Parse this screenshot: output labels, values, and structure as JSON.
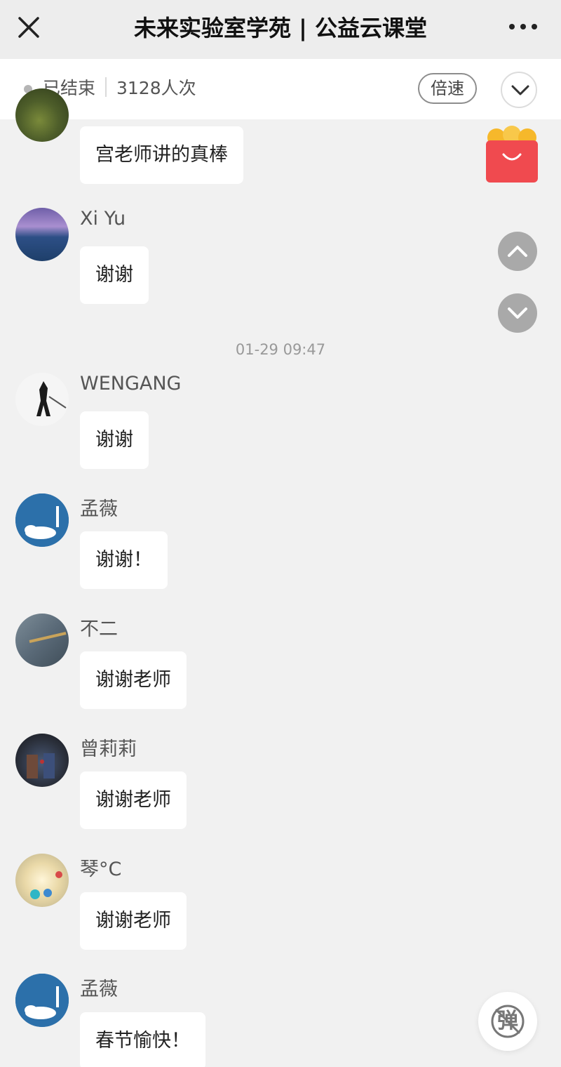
{
  "header": {
    "title": "未来实验室学苑 | 公益云课堂",
    "close_icon": "close-icon",
    "more_icon": "more-icon"
  },
  "status": {
    "state": "已结束",
    "viewers": "3128人次",
    "speed_label": "倍速",
    "collapse_icon": "chevron-down-icon"
  },
  "timestamp": "01-29 09:47",
  "messages": [
    {
      "user": "",
      "text": "宫老师讲的真棒"
    },
    {
      "user": "Xi Yu",
      "text": "谢谢"
    },
    {
      "user": "WENGANG",
      "text": "谢谢"
    },
    {
      "user": "孟薇",
      "text": "谢谢！"
    },
    {
      "user": "不二",
      "text": "谢谢老师"
    },
    {
      "user": "曾莉莉",
      "text": "谢谢老师"
    },
    {
      "user": "琴°C",
      "text": "谢谢老师"
    },
    {
      "user": "孟薇",
      "text": "春节愉快！"
    }
  ],
  "floating": {
    "gift_icon": "gift-bag-icon",
    "scroll_up_icon": "chevron-up-icon",
    "scroll_down_icon": "chevron-down-icon",
    "danmaku_label": "弹",
    "danmaku_icon": "danmaku-off-icon"
  },
  "colors": {
    "background": "#f1f1f1",
    "bubble": "#ffffff",
    "gift_red": "#f04a4f",
    "gift_gold": "#f6b82b"
  }
}
